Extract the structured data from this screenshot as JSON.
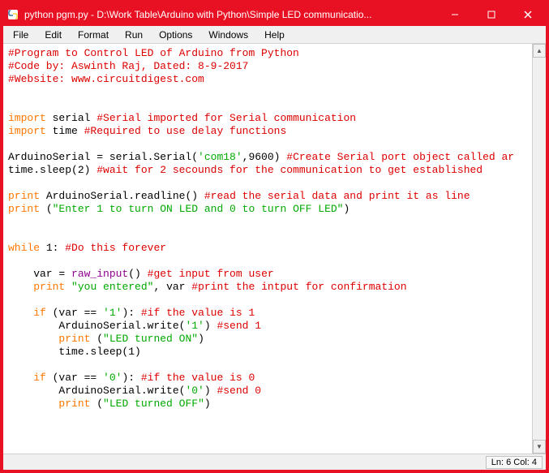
{
  "titlebar": {
    "text": "python pgm.py - D:\\Work Table\\Arduino with Python\\Simple LED communicatio..."
  },
  "menu": {
    "file": "File",
    "edit": "Edit",
    "format": "Format",
    "run": "Run",
    "options": "Options",
    "windows": "Windows",
    "help": "Help"
  },
  "status": {
    "position": "Ln: 6 Col: 4"
  },
  "code": {
    "l1": "#Program to Control LED of Arduino from Python",
    "l2": "#Code by: Aswinth Raj, Dated: 8-9-2017",
    "l3": "#Website: www.circuitdigest.com",
    "l4": "",
    "l5": "",
    "l6a": "import",
    "l6b": " serial ",
    "l6c": "#Serial imported for Serial communication",
    "l7a": "import",
    "l7b": " time ",
    "l7c": "#Required to use delay functions",
    "l8": "",
    "l9a": "ArduinoSerial = serial.Serial(",
    "l9b": "'com18'",
    "l9c": ",9600) ",
    "l9d": "#Create Serial port object called ar",
    "l10a": "time.sleep(2) ",
    "l10b": "#wait for 2 secounds for the communication to get established",
    "l11": "",
    "l12a": "print",
    "l12b": " ArduinoSerial.readline() ",
    "l12c": "#read the serial data and print it as line",
    "l13a": "print",
    "l13b": " (",
    "l13c": "\"Enter 1 to turn ON LED and 0 to turn OFF LED\"",
    "l13d": ")",
    "l14": "",
    "l15": "",
    "l16a": "while",
    "l16b": " 1: ",
    "l16c": "#Do this forever",
    "l17": "",
    "l18a": "    var = ",
    "l18b": "raw_input",
    "l18c": "() ",
    "l18d": "#get input from user",
    "l19a": "    ",
    "l19b": "print",
    "l19c": " ",
    "l19d": "\"you entered\"",
    "l19e": ", var ",
    "l19f": "#print the intput for confirmation",
    "l20": "",
    "l21a": "    ",
    "l21b": "if",
    "l21c": " (var == ",
    "l21d": "'1'",
    "l21e": "): ",
    "l21f": "#if the value is 1",
    "l22a": "        ArduinoSerial.write(",
    "l22b": "'1'",
    "l22c": ") ",
    "l22d": "#send 1",
    "l23a": "        ",
    "l23b": "print",
    "l23c": " (",
    "l23d": "\"LED turned ON\"",
    "l23e": ")",
    "l24": "        time.sleep(1)",
    "l25": "",
    "l26a": "    ",
    "l26b": "if",
    "l26c": " (var == ",
    "l26d": "'0'",
    "l26e": "): ",
    "l26f": "#if the value is 0",
    "l27a": "        ArduinoSerial.write(",
    "l27b": "'0'",
    "l27c": ") ",
    "l27d": "#send 0",
    "l28a": "        ",
    "l28b": "print",
    "l28c": " (",
    "l28d": "\"LED turned OFF\"",
    "l28e": ")"
  }
}
